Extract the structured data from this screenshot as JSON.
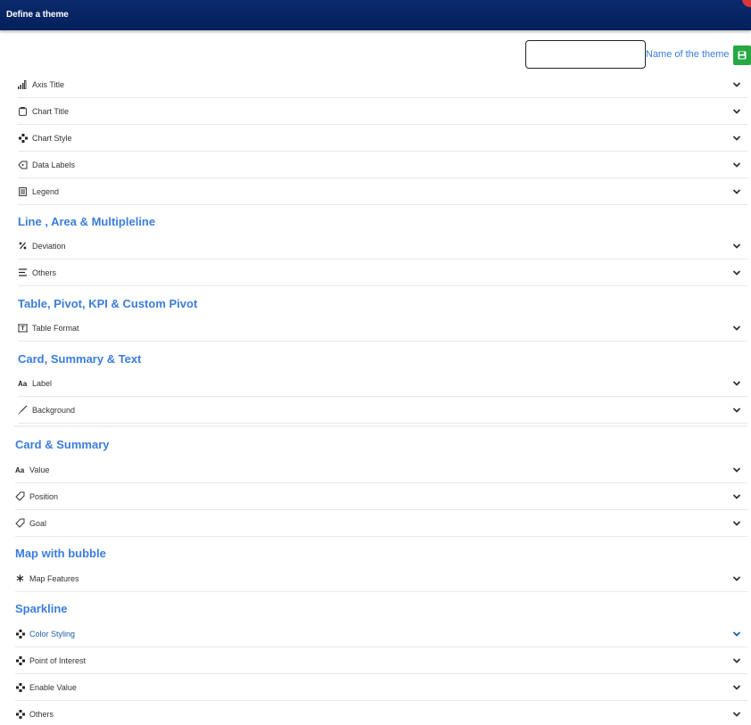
{
  "window": {
    "title": "Define a theme"
  },
  "theme_name": {
    "value": "",
    "placeholder": "",
    "label": "Name of the theme"
  },
  "general_items": [
    {
      "label": "Axis Title",
      "icon": "bar-chart-icon"
    },
    {
      "label": "Chart Title",
      "icon": "chart-title-icon"
    },
    {
      "label": "Chart Style",
      "icon": "style-icon"
    },
    {
      "label": "Data Labels",
      "icon": "tag-icon"
    },
    {
      "label": "Legend",
      "icon": "legend-icon"
    }
  ],
  "sections": {
    "line": {
      "title": "Line , Area & Multipleline",
      "items": [
        {
          "label": "Deviation",
          "icon": "percent-icon"
        },
        {
          "label": "Others",
          "icon": "list-icon"
        }
      ]
    },
    "table": {
      "title": "Table, Pivot, KPI & Custom Pivot",
      "items": [
        {
          "label": "Table Format",
          "icon": "table-icon"
        }
      ]
    },
    "card_text": {
      "title": "Card, Summary & Text",
      "items": [
        {
          "label": "Label",
          "icon": "font-icon"
        },
        {
          "label": "Background",
          "icon": "brush-icon"
        }
      ]
    },
    "card_summary": {
      "title": "Card & Summary",
      "items": [
        {
          "label": "Value",
          "icon": "font-icon"
        },
        {
          "label": "Position",
          "icon": "tag-icon"
        },
        {
          "label": "Goal",
          "icon": "tag-icon"
        }
      ]
    },
    "map": {
      "title": "Map with bubble",
      "items": [
        {
          "label": "Map Features",
          "icon": "asterisk-icon"
        }
      ]
    },
    "sparkline": {
      "title": "Sparkline",
      "items": [
        {
          "label": "Color Styling",
          "icon": "style-icon"
        },
        {
          "label": "Point of Interest",
          "icon": "style-icon"
        },
        {
          "label": "Enable Value",
          "icon": "style-icon"
        },
        {
          "label": "Others",
          "icon": "style-icon"
        }
      ]
    }
  },
  "colors": {
    "header": "#04205c",
    "accent": "#3b7ddd",
    "save": "#27a844"
  }
}
